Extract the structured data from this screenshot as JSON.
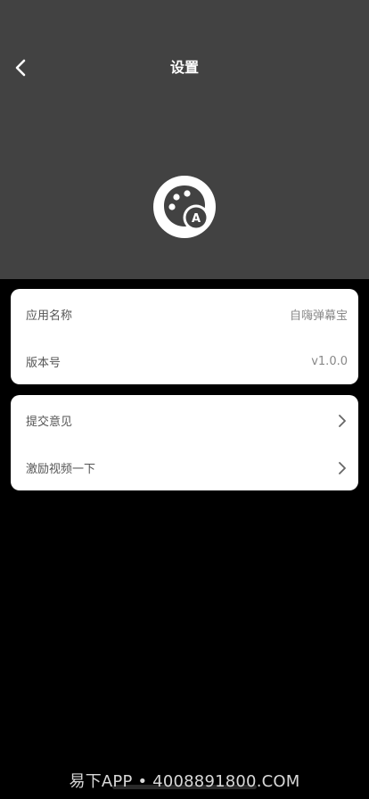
{
  "header": {
    "title": "设置",
    "background": "#424242",
    "back_icon": "chevron-left-icon",
    "logo_icon": "palette-a-logo"
  },
  "info_card": {
    "items": [
      {
        "label": "应用名称",
        "value": "自嗨弹幕宝"
      },
      {
        "label": "版本号",
        "value": "v1.0.0"
      }
    ]
  },
  "action_card": {
    "items": [
      {
        "label": "提交意见",
        "icon": "chevron-right-icon"
      },
      {
        "label": "激励视频一下",
        "icon": "chevron-right-icon"
      }
    ]
  },
  "watermark": "易下APP • 4008891800.COM"
}
